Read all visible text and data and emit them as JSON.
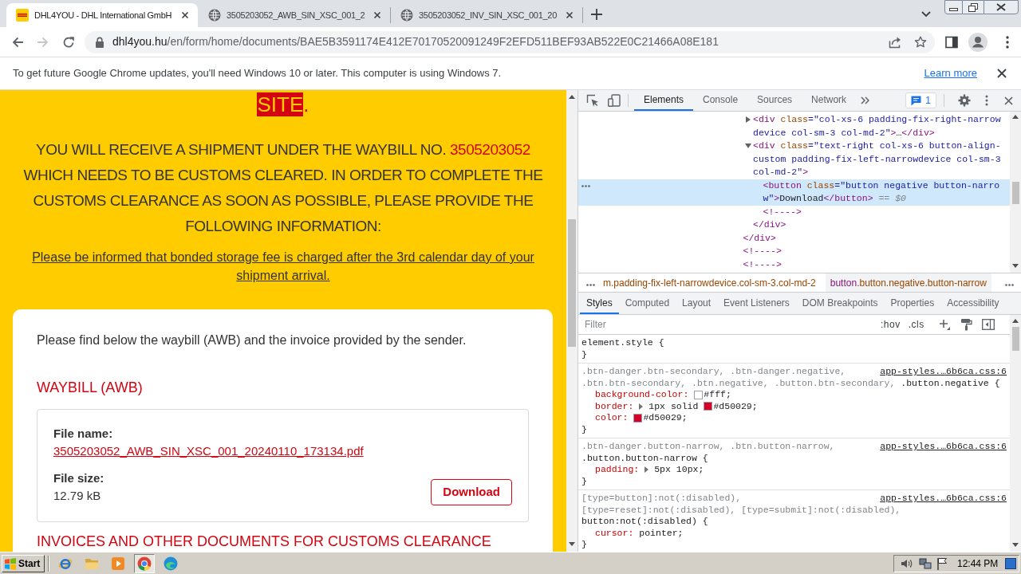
{
  "browser": {
    "tabs": [
      {
        "kind": "site",
        "title": "DHL4YOU - DHL International GmbH",
        "selected": true
      },
      {
        "kind": "globe",
        "title": "3505203052_AWB_SIN_XSC_001_2",
        "selected": false
      },
      {
        "kind": "globe",
        "title": "3505203052_INV_SIN_XSC_001_20",
        "selected": false
      }
    ],
    "navigation": {
      "back_disabled": false,
      "forward_disabled": true
    },
    "address": {
      "host": "dhl4you.hu",
      "path": "/en/form/home/documents/BAE5B3591174E412E70170520091249F2EFD511BEF93AB522E0C21466A08E181"
    },
    "infobar": {
      "message": "To get future Google Chrome updates, you'll need Windows 10 or later. This computer is using Windows 7.",
      "link": "Learn more"
    }
  },
  "page": {
    "heading_fragment": [
      {
        "text": "SITE",
        "highlight": true
      },
      {
        "text": ".",
        "highlight": false
      }
    ],
    "notice": [
      {
        "text": "YOU WILL RECEIVE A SHIPMENT UNDER THE WAYBILL NO. ",
        "highlight": false
      },
      {
        "text": "3505203052",
        "highlight": true
      },
      {
        "text": " WHICH NEEDS TO BE CUSTOMS CLEARED. IN ORDER TO COMPLETE THE CUSTOMS CLEARANCE AS SOON AS POSSIBLE, PLEASE PROVIDE THE FOLLOWING INFORMATION:",
        "highlight": false
      }
    ],
    "storage_note": "Please be informed that bonded storage fee is charged after the 3rd calendar day of your shipment arrival.",
    "card": {
      "intro": "Please find below the waybill (AWB) and the invoice provided by the sender.",
      "sections": [
        {
          "title": "WAYBILL (AWB)",
          "files": [
            {
              "name_label": "File name:",
              "name": "3505203052_AWB_SIN_XSC_001_20240110_173134.pdf",
              "size_label": "File size:",
              "size": "12.79 kB",
              "action": "Download"
            }
          ]
        },
        {
          "title": "INVOICES AND OTHER DOCUMENTS FOR CUSTOMS CLEARANCE"
        }
      ]
    }
  },
  "devtools": {
    "panels": [
      {
        "label": "Elements",
        "selected": true
      },
      {
        "label": "Console",
        "selected": false
      },
      {
        "label": "Sources",
        "selected": false
      },
      {
        "label": "Network",
        "selected": false
      }
    ],
    "issues_count": "1",
    "dom_tree": [
      {
        "kind": "container",
        "selected": false,
        "children": [
          {
            "kind": "element",
            "expanded": false,
            "selected": false,
            "tokens": [
              {
                "kind": "tag",
                "text": "<div"
              },
              {
                "kind": "attr",
                "text": " class"
              },
              {
                "kind": "value",
                "text": "=\"col-xs-6 padding-fix-right-narrow device col-sm-3 col-md-2\""
              },
              {
                "kind": "tag",
                "text": ">"
              },
              {
                "kind": "text",
                "text": "…"
              },
              {
                "kind": "tag",
                "text": "</div>"
              }
            ]
          },
          {
            "kind": "element",
            "expanded": true,
            "selected": false,
            "tokens": [
              {
                "kind": "tag",
                "text": "<div"
              },
              {
                "kind": "attr",
                "text": " class"
              },
              {
                "kind": "value",
                "text": "=\"text-right col-xs-6 button-align-custom padding-fix-left-narrowdevice col-sm-3 col-md-2\""
              },
              {
                "kind": "tag",
                "text": ">"
              }
            ],
            "children": [
              {
                "kind": "leaf",
                "selected": true,
                "tokens": [
                  {
                    "kind": "tag",
                    "text": "<button"
                  },
                  {
                    "kind": "attr",
                    "text": " class"
                  },
                  {
                    "kind": "value",
                    "text": "=\"button negative button-narrow\""
                  },
                  {
                    "kind": "tag",
                    "text": ">"
                  },
                  {
                    "kind": "text",
                    "text": "Download"
                  },
                  {
                    "kind": "tag",
                    "text": "</button>"
                  },
                  {
                    "kind": "ref",
                    "text": " == $0"
                  }
                ]
              },
              {
                "kind": "leaf",
                "selected": false,
                "tokens": [
                  {
                    "kind": "tag",
                    "text": "<!---->"
                  }
                ]
              }
            ],
            "close": [
              {
                "kind": "tag",
                "text": "</div>"
              }
            ]
          }
        ],
        "close": [
          {
            "kind": "tag",
            "text": "</div>"
          }
        ]
      },
      {
        "kind": "leaf",
        "selected": false,
        "tokens": [
          {
            "kind": "tag",
            "text": "<!---->"
          }
        ]
      },
      {
        "kind": "leaf",
        "selected": false,
        "tokens": [
          {
            "kind": "tag",
            "text": "<!---->"
          }
        ]
      }
    ],
    "breadcrumbs": [
      {
        "selected": false,
        "tokens": [
          {
            "kind": "attr",
            "text": "m.padding-fix-left-narrowdevice.col-sm-3.col-md-2"
          }
        ]
      },
      {
        "selected": true,
        "tokens": [
          {
            "kind": "tag",
            "text": "button"
          },
          {
            "kind": "attr",
            "text": ".button.negative.button-narrow"
          }
        ]
      }
    ],
    "sidebar_tabs": [
      {
        "label": "Styles",
        "selected": true
      },
      {
        "label": "Computed",
        "selected": false
      },
      {
        "label": "Layout",
        "selected": false
      },
      {
        "label": "Event Listeners",
        "selected": false
      },
      {
        "label": "DOM Breakpoints",
        "selected": false
      },
      {
        "label": "Properties",
        "selected": false
      },
      {
        "label": "Accessibility",
        "selected": false
      }
    ],
    "filter": {
      "placeholder": "Filter"
    },
    "filter_buttons": [
      ":hov",
      ".cls"
    ],
    "rules": [
      {
        "selectors": [
          {
            "text": "element.style",
            "matched": true
          }
        ],
        "open": "{",
        "close": "}"
      },
      {
        "selectors": [
          {
            "text": ".btn-danger.btn-secondary,",
            "matched": false
          },
          {
            "text": ".btn-danger.negative,",
            "matched": false
          },
          {
            "text": ".btn.btn-secondary,",
            "matched": false
          },
          {
            "text": ".btn.negative,",
            "matched": false
          },
          {
            "text": ".button.btn-secondary,",
            "matched": false
          },
          {
            "text": ".button.negative",
            "matched": true
          }
        ],
        "open": "{",
        "source": "app-styles.…6b6ca.css:6",
        "declarations": [
          {
            "kind": "plain",
            "property": "background-color:",
            "value": [
              {
                "text": "#fff;",
                "color": "#ffffff"
              }
            ]
          },
          {
            "kind": "shorthand",
            "property": "border:",
            "value": [
              {
                "text": "1px solid"
              },
              {
                "text": "#d50029;",
                "color": "#d50029"
              }
            ]
          },
          {
            "kind": "plain",
            "property": "color:",
            "value": [
              {
                "text": "#d50029;",
                "color": "#d50029"
              }
            ]
          }
        ],
        "close": "}"
      },
      {
        "selectors": [
          {
            "text": ".btn-danger.button-narrow,",
            "matched": false
          },
          {
            "text": ".btn.button-narrow,",
            "matched": false
          },
          {
            "text": ".button.button-narrow",
            "matched": true
          }
        ],
        "open": "{",
        "source": "app-styles.…6b6ca.css:6",
        "declarations": [
          {
            "kind": "shorthand",
            "property": "padding:",
            "value": [
              {
                "text": "5px 10px;"
              }
            ]
          }
        ],
        "close": "}"
      },
      {
        "selectors": [
          {
            "text": "[type=button]:not(:disabled),",
            "matched": false
          },
          {
            "text": "[type=reset]:not(:disabled),",
            "matched": false
          },
          {
            "text": "[type=submit]:not(:disabled),",
            "matched": false
          },
          {
            "text": "button:not(:disabled)",
            "matched": true
          }
        ],
        "open": "{",
        "source": "app-styles.…6b6ca.css:6",
        "declarations": [
          {
            "kind": "plain",
            "property": "cursor:",
            "value": [
              {
                "text": "pointer;"
              }
            ]
          }
        ],
        "close": "}"
      }
    ]
  },
  "taskbar": {
    "start": "Start",
    "apps": [
      {
        "kind": "e_logo",
        "selected": false
      },
      {
        "kind": "folder",
        "selected": false
      },
      {
        "kind": "player",
        "selected": false
      },
      {
        "kind": "round_logo",
        "selected": true
      },
      {
        "kind": "wave_logo",
        "selected": false
      }
    ],
    "clock": "12:44 PM"
  }
}
